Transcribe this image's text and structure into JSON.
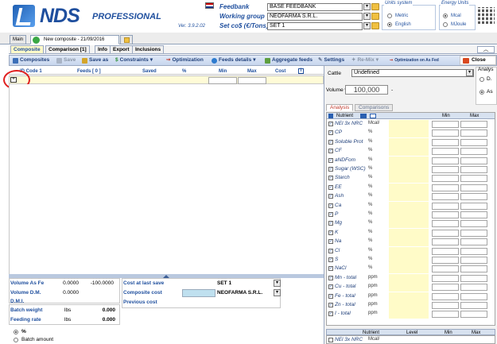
{
  "header": {
    "logo_main": "NDS",
    "logo_sub": "PROFESSIONAL",
    "version": "Ver. 3.9.2.02",
    "feedbank_label": "Feedbank",
    "feedbank_value": "BASE FEEDBANK",
    "working_group_label": "Working group",
    "working_group_value": "NEOFARMA S.R.L.",
    "set_label": "Set co$ (€/Tons)",
    "set_value": "SET 1",
    "units_title": "Units system",
    "units_metric": "Metric",
    "units_english": "English",
    "energy_title": "Energy Units",
    "energy_mcal": "Mcal",
    "energy_mjoule": "MJoule"
  },
  "tabs": {
    "main": "Main",
    "composite_doc": "New composite - 21/09/2016"
  },
  "subtabs": [
    "Composite",
    "Comparison [1]",
    "Info",
    "Export",
    "Inclusions"
  ],
  "toolbar": {
    "composites": "Composites",
    "save": "Save",
    "save_as": "Save as",
    "constraints": "Constraints",
    "optimization": "Optimization",
    "feeds_details": "Feeds details",
    "aggregate_feeds": "Aggregate feeds",
    "settings": "Settings",
    "re_mix": "Re-Mix",
    "optimization_as_fed": "Optimization on As Fed",
    "close": "Close"
  },
  "grid": {
    "headers": {
      "code": "ID Code 1",
      "feeds": "Feeds  [ 0 ]",
      "saved": "Saved",
      "pct": "%",
      "min": "Min",
      "max": "Max",
      "cost": "Cost",
      "info": "i"
    },
    "row_marker": "+"
  },
  "bottom": {
    "volume_as_fed_label": "Volume As Fe",
    "volume_as_fed_value": "0.0000",
    "volume_as_fed_diff": "-100.0000",
    "volume_dm_label": "Volume D.M.",
    "volume_dm_value": "0.0000",
    "dmi_label": "D.M.I.",
    "batch_weight_label": "Batch weight",
    "batch_weight_unit": "lbs",
    "batch_weight_value": "0.000",
    "feeding_rate_label": "Feeding rate",
    "feeding_rate_unit": "lbs",
    "feeding_rate_value": "0.000",
    "radio_pct": "%",
    "radio_batch": "Batch amount",
    "cost_last_save_label": "Cost at last save",
    "cost_last_save_value": "SET 1",
    "composite_cost_label": "Composite cost",
    "composite_cost_value": "NEOFARMA S.R.L.",
    "previous_cost_label": "Previous cost"
  },
  "right": {
    "cattle_label": "Cattle",
    "cattle_value": "Undefined",
    "volume_label": "Volume %",
    "volume_value": "100,000",
    "volume_dash": "-",
    "analysis_title": "Analys",
    "analysis_opt1": "D.",
    "analysis_opt2": "As",
    "tab_analysis": "Analysis",
    "tab_comparisons": "Comparisons",
    "nut_header": "Nutrient",
    "nut_min": "Min",
    "nut_max": "Max",
    "nut_level": "Level",
    "nutrients": [
      {
        "name": "NEl 3x NRC",
        "unit": "Mcal/"
      },
      {
        "name": "CP",
        "unit": "%"
      },
      {
        "name": "Soluble Prot",
        "unit": "%"
      },
      {
        "name": "CF",
        "unit": "%"
      },
      {
        "name": "aNDFom",
        "unit": "%"
      },
      {
        "name": "Sugar (WSC)",
        "unit": "%"
      },
      {
        "name": "Starch",
        "unit": "%"
      },
      {
        "name": "EE",
        "unit": "%"
      },
      {
        "name": "Ash",
        "unit": "%"
      },
      {
        "name": "Ca",
        "unit": "%"
      },
      {
        "name": "P",
        "unit": "%"
      },
      {
        "name": "Mg",
        "unit": "%"
      },
      {
        "name": "K",
        "unit": "%"
      },
      {
        "name": "Na",
        "unit": "%"
      },
      {
        "name": "Cl",
        "unit": "%"
      },
      {
        "name": "S",
        "unit": "%"
      },
      {
        "name": "NaCl",
        "unit": "%"
      },
      {
        "name": "Mn - total",
        "unit": "ppm"
      },
      {
        "name": "Cu - total",
        "unit": "ppm"
      },
      {
        "name": "Fe - total",
        "unit": "ppm"
      },
      {
        "name": "Zn - total",
        "unit": "ppm"
      },
      {
        "name": "I - total",
        "unit": "ppm"
      }
    ],
    "last_row_name": "NEl 3x NRC",
    "last_row_unit": "Mcal/"
  },
  "colors": {
    "brand_blue": "#1f4f9e",
    "row_yellow": "#fffbd7",
    "highlight_red": "#e02020"
  }
}
